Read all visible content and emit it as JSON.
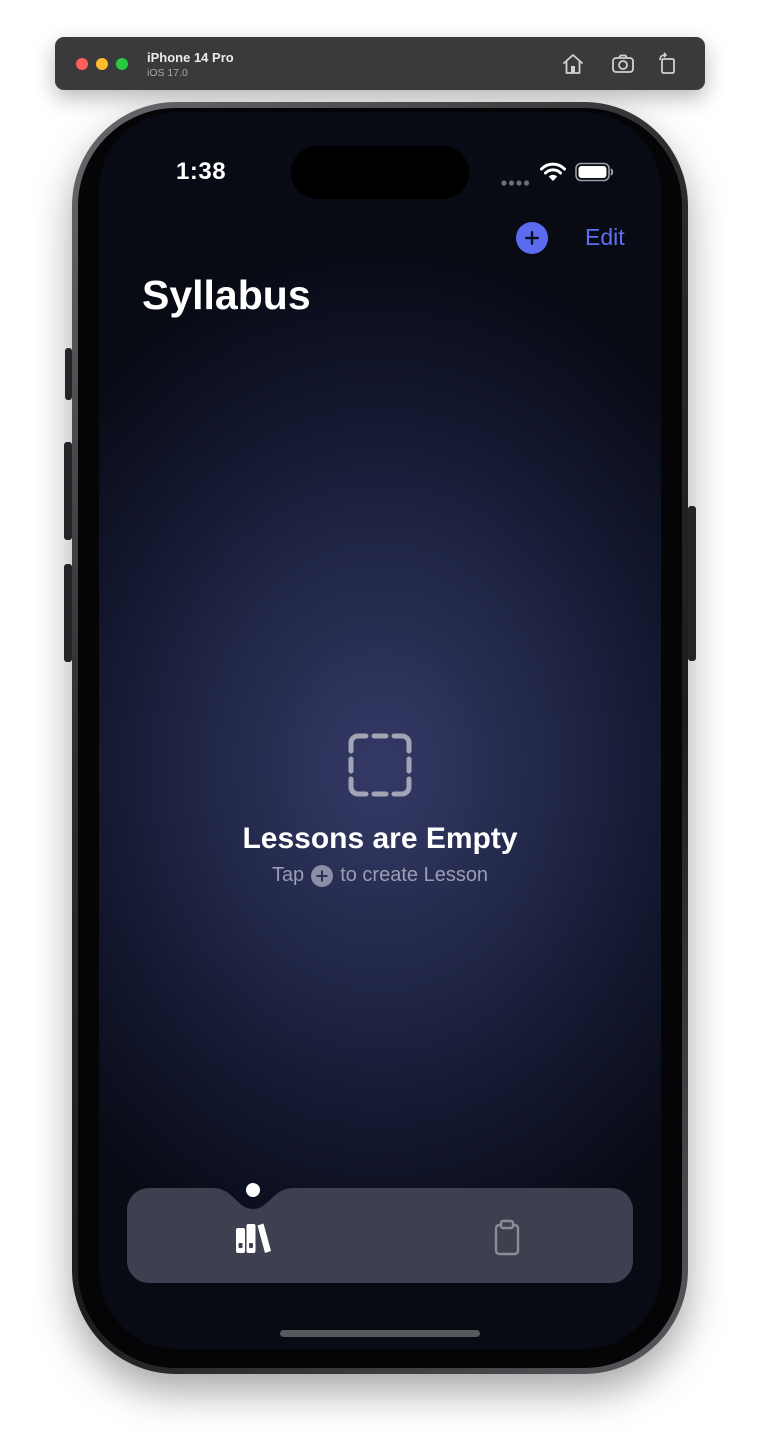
{
  "simulator": {
    "device_name": "iPhone 14 Pro",
    "os_version": "iOS 17.0",
    "toolbar_icons": [
      "home-icon",
      "screenshot-icon",
      "rotate-icon"
    ]
  },
  "status_bar": {
    "time": "1:38",
    "icons": [
      "cellular-signal-icon",
      "wifi-icon",
      "battery-icon"
    ]
  },
  "nav": {
    "add_icon": "plus-circle-icon",
    "edit_label": "Edit"
  },
  "page": {
    "title": "Syllabus"
  },
  "empty_state": {
    "icon": "dashed-square-icon",
    "title": "Lessons are Empty",
    "hint_prefix": "Tap",
    "hint_icon": "plus-circle-icon",
    "hint_suffix": "to create Lesson"
  },
  "tab_bar": {
    "tabs": [
      {
        "icon": "books-icon",
        "selected": true
      },
      {
        "icon": "clipboard-icon",
        "selected": false
      }
    ]
  },
  "colors": {
    "accent": "#5b6cf0",
    "background_center": "#343a66",
    "background_edge": "#080a14",
    "tab_bar": "#3e4050"
  }
}
